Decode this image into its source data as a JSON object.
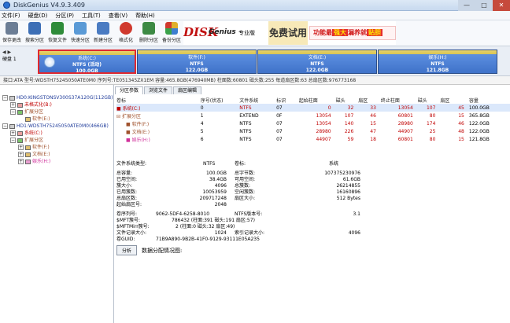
{
  "window": {
    "title": "DiskGenius V4.9.3.409",
    "min": "—",
    "max": "□",
    "close": "✕"
  },
  "menu": [
    "文件(F)",
    "硬盘(D)",
    "分区(P)",
    "工具(T)",
    "查看(V)",
    "帮助(H)"
  ],
  "toolbar": [
    {
      "label": "保存更改",
      "icon": "save-icon",
      "color": "#6b7d95"
    },
    {
      "label": "搜索分区",
      "icon": "search-icon",
      "color": "#3d6fb6"
    },
    {
      "label": "恢复文件",
      "icon": "recover-icon",
      "color": "#2f8c3a"
    },
    {
      "label": "快速分区",
      "icon": "quick-partition-icon",
      "color": "#5a9ad6"
    },
    {
      "label": "新建分区",
      "icon": "new-partition-icon",
      "color": "#4a7bc2"
    },
    {
      "label": "格式化",
      "icon": "format-icon",
      "color": "#d03a2e"
    },
    {
      "label": "删除分区",
      "icon": "delete-icon",
      "color": "#3d8a44"
    },
    {
      "label": "备份分区",
      "icon": "backup-icon",
      "color": "#d9a72c"
    }
  ],
  "banner": {
    "logo": "DISK",
    "logo2": "Genius",
    "pro": "专业版",
    "ad1": "免费试用",
    "ad2a": "功能最",
    "ad2b": "强大",
    "ad2c": "漏养就",
    "ad2d": "贴胆"
  },
  "diskbar": {
    "disk_label": "硬盘 1",
    "partitions": [
      {
        "name": "系统(C:)",
        "fs": "NTFS (活动)",
        "size": "100.0GB"
      },
      {
        "name": "软件(F:)",
        "fs": "NTFS",
        "size": "122.0GB"
      },
      {
        "name": "文档(E:)",
        "fs": "NTFS",
        "size": "122.0GB"
      },
      {
        "name": "娱乐(H:)",
        "fs": "NTFS",
        "size": "121.8GB"
      }
    ]
  },
  "infobar": "接口:ATA   型号:WDSTH75245050ATE0M0   序列号:TE051345ZX1EM   容量:465.8GB(476940MB)   柱面数:60801   磁头数:255   每道扇区数:63   总扇区数:976773168",
  "tree": [
    {
      "label": "HD0:KINGSTONSV300S37A120G(112GB)",
      "cls": "c-blue",
      "indent": 0,
      "exp": "−"
    },
    {
      "label": "未格式化(B:)",
      "cls": "c-red",
      "indent": 1,
      "exp": "+"
    },
    {
      "label": "扩展分区",
      "cls": "c-brown",
      "indent": 1,
      "exp": "−"
    },
    {
      "label": "软件(E:)",
      "cls": "c-brown",
      "indent": 2,
      "exp": ""
    },
    {
      "label": "HD1:WDSTH75245050ATE0M0(466GB)",
      "cls": "c-blue",
      "indent": 0,
      "exp": "−"
    },
    {
      "label": "系统(C:)",
      "cls": "c-red",
      "indent": 1,
      "exp": "+"
    },
    {
      "label": "扩展分区",
      "cls": "c-brown",
      "indent": 1,
      "exp": "−"
    },
    {
      "label": "软件(F:)",
      "cls": "c-brown",
      "indent": 2,
      "exp": "+"
    },
    {
      "label": "文档(E:)",
      "cls": "c-brown",
      "indent": 2,
      "exp": "+"
    },
    {
      "label": "娱乐(H:)",
      "cls": "c-pink",
      "indent": 2,
      "exp": "+"
    }
  ],
  "tabs": [
    "分区参数",
    "浏览文件",
    "扇区编辑"
  ],
  "table": {
    "headers": [
      "卷标",
      "序号(状态)",
      "文件系统",
      "标识",
      "起始柱面",
      "磁头",
      "扇区",
      "终止柱面",
      "磁头",
      "扇区",
      "容量"
    ],
    "rows": [
      {
        "cells": [
          "系统(C:)",
          "0",
          "NTFS",
          "07",
          "0",
          "32",
          "33",
          "13054",
          "107",
          "45",
          "100.0GB"
        ],
        "hl": true
      },
      {
        "cells": [
          "扩展分区",
          "1",
          "EXTEND",
          "0F",
          "13054",
          "107",
          "46",
          "60801",
          "80",
          "15",
          "365.8GB"
        ],
        "hl": false
      },
      {
        "cells": [
          "软件(F:)",
          "4",
          "NTFS",
          "07",
          "13054",
          "140",
          "15",
          "28980",
          "174",
          "46",
          "122.0GB"
        ],
        "hl": false
      },
      {
        "cells": [
          "文档(E:)",
          "5",
          "NTFS",
          "07",
          "28980",
          "226",
          "47",
          "44907",
          "25",
          "48",
          "122.0GB"
        ],
        "hl": false
      },
      {
        "cells": [
          "娱乐(H:)",
          "6",
          "NTFS",
          "07",
          "44907",
          "59",
          "18",
          "60801",
          "80",
          "15",
          "121.8GB"
        ],
        "hl": false
      }
    ]
  },
  "fs": {
    "fstype_label": "文件系统类型:",
    "fstype": "NTFS",
    "vol_label": "卷标:",
    "vol": "系统",
    "rows": [
      [
        "总容量:",
        "100.0GB",
        "总字节数:",
        "107375230976"
      ],
      [
        "已用空间:",
        "38.4GB",
        "可用空间:",
        "61.6GB"
      ],
      [
        "簇大小:",
        "4096",
        "总簇数:",
        "26214855"
      ],
      [
        "已用簇数:",
        "10053959",
        "空闲簇数:",
        "16160896"
      ],
      [
        "总扇区数:",
        "209717248",
        "扇区大小:",
        "512 Bytes"
      ],
      [
        "起始扇区号:",
        "2048",
        "",
        ""
      ]
    ],
    "rows2": [
      [
        "卷序列号:",
        "9062-5DF4-6258-8010",
        "NTFS版本号:",
        "3.1"
      ],
      [
        "$MFT簇号:",
        "786432 (柱面:391 磁头:191 扇区:57)",
        "",
        ""
      ],
      [
        "$MFTMirr簇号:",
        "2 (柱面:0 磁头:32 扇区:49)",
        "",
        ""
      ],
      [
        "文件记录大小:",
        "1024",
        "索引记录大小:",
        "4096"
      ],
      [
        "卷GUID:",
        "71B9A890-9B2B-41F0-9129-93111E05A235",
        "",
        ""
      ]
    ]
  },
  "analysis": {
    "button": "分析",
    "label": "数据分配情况图:"
  }
}
